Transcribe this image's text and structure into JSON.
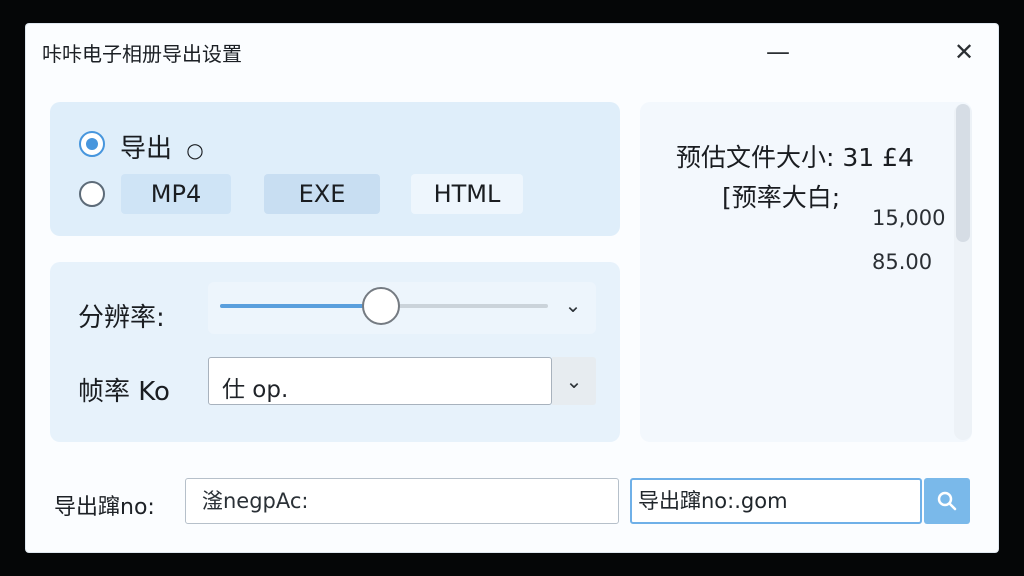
{
  "window": {
    "title": "咔咔电子相册导出设置"
  },
  "controls": {
    "minimize_symbol": "—",
    "close_symbol": "✕"
  },
  "export_options": {
    "radio1_label": "导出",
    "radio1_suffix": "○",
    "formats": [
      "MP4",
      "EXE",
      "HTML"
    ]
  },
  "settings": {
    "resolution_label": "分辨率:",
    "resolution_progress": 0.49,
    "fps_label": "帧率 Ko",
    "fps_value": "仕 op."
  },
  "preview": {
    "line1": "预估文件大小: 31 £4",
    "line2": "[预率大白;",
    "num1": "15,000",
    "num2": "85.00"
  },
  "bottom": {
    "path_label": "导出蹿no:",
    "path_value": "滏negpAc:",
    "url_value": "导出蹿no:.gom"
  },
  "colors": {
    "accent": "#4796dd",
    "panel": "#dfeefa",
    "search_button": "#7ab9ea"
  },
  "icons": {
    "search": "search-icon",
    "dropdown": "chevron-down-icon"
  }
}
